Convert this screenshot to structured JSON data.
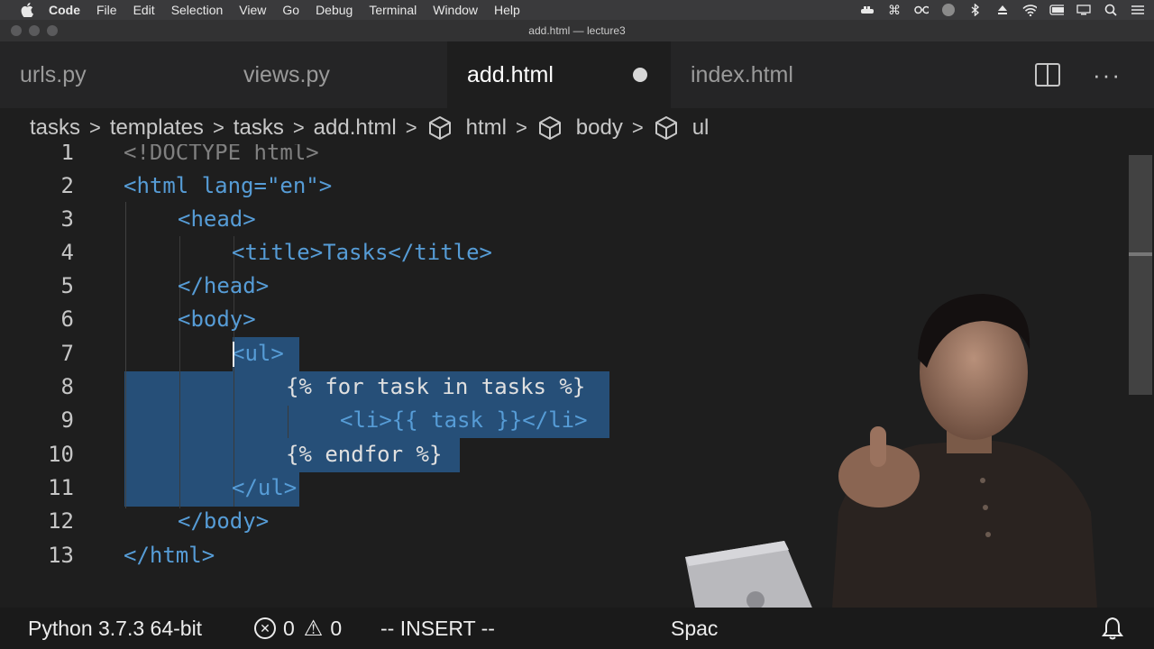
{
  "menubar": {
    "items": [
      "Code",
      "File",
      "Edit",
      "Selection",
      "View",
      "Go",
      "Debug",
      "Terminal",
      "Window",
      "Help"
    ]
  },
  "window": {
    "title": "add.html — lecture3"
  },
  "tabs": [
    {
      "label": "urls.py",
      "active": false
    },
    {
      "label": "views.py",
      "active": false
    },
    {
      "label": "add.html",
      "active": true,
      "dirty": true
    },
    {
      "label": "index.html",
      "active": false
    }
  ],
  "breadcrumb": [
    "tasks",
    "templates",
    "tasks",
    "add.html",
    "html",
    "body",
    "ul"
  ],
  "editor": {
    "lines": [
      {
        "n": "1",
        "text": "<!DOCTYPE html>"
      },
      {
        "n": "2",
        "text": "<html lang=\"en\">"
      },
      {
        "n": "3",
        "text": "<head>"
      },
      {
        "n": "4",
        "text": "<title>Tasks</title>"
      },
      {
        "n": "5",
        "text": "</head>"
      },
      {
        "n": "6",
        "text": "<body>"
      },
      {
        "n": "7",
        "text": "<ul>"
      },
      {
        "n": "8",
        "text": "{% for task in tasks %}"
      },
      {
        "n": "9",
        "text": "<li>{{ task }}</li>"
      },
      {
        "n": "10",
        "text": "{% endfor %}"
      },
      {
        "n": "11",
        "text": "</ul>"
      },
      {
        "n": "12",
        "text": "</body>"
      },
      {
        "n": "13",
        "text": "</html>"
      }
    ]
  },
  "statusbar": {
    "python": "Python 3.7.3 64-bit",
    "errors": "0",
    "warnings": "0",
    "mode": "-- INSERT --",
    "spaces": "Spac"
  },
  "colors": {
    "selection": "#264f78",
    "tag_name": "#569cd6",
    "attr_name": "#9cdcfe",
    "attr_value": "#ce9178"
  }
}
